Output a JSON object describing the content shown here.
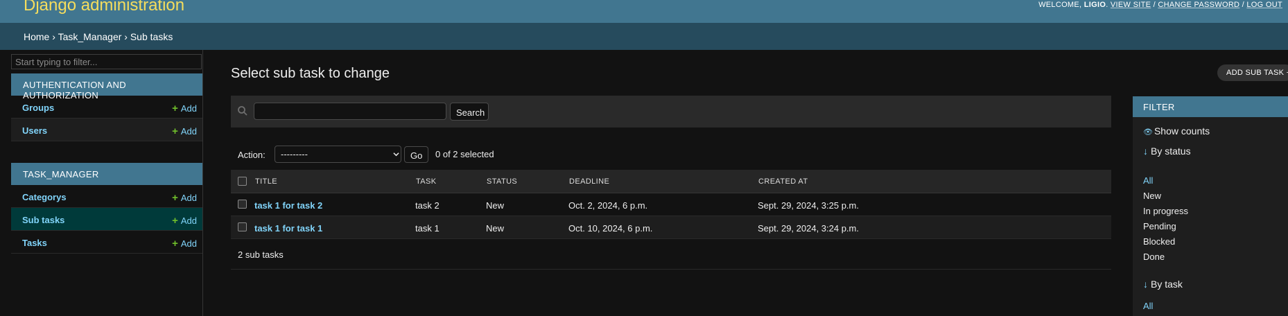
{
  "header": {
    "brand": "Django administration",
    "welcome": "WELCOME,",
    "username": "LIGIO",
    "view_site": "VIEW SITE",
    "change_password": "CHANGE PASSWORD",
    "log_out": "LOG OUT",
    "separator": "/"
  },
  "breadcrumbs": {
    "home": "Home",
    "app": "Task_Manager",
    "current": "Sub tasks",
    "separator": "›"
  },
  "sidebar": {
    "filter_placeholder": "Start typing to filter...",
    "apps": [
      {
        "caption": "AUTHENTICATION AND AUTHORIZATION",
        "models": [
          {
            "name": "Groups",
            "add": "Add"
          },
          {
            "name": "Users",
            "add": "Add"
          }
        ]
      },
      {
        "caption": "TASK_MANAGER",
        "models": [
          {
            "name": "Categorys",
            "add": "Add"
          },
          {
            "name": "Sub tasks",
            "add": "Add"
          },
          {
            "name": "Tasks",
            "add": "Add"
          }
        ]
      }
    ]
  },
  "content": {
    "title": "Select sub task to change",
    "add_button": "ADD SUB TASK",
    "search_button": "Search",
    "search_value": "",
    "action_label": "Action:",
    "action_selected": "---------",
    "go_button": "Go",
    "selection_count": "0 of 2 selected",
    "columns": [
      "TITLE",
      "TASK",
      "STATUS",
      "DEADLINE",
      "CREATED AT"
    ],
    "rows": [
      {
        "title": "task 1 for task 2",
        "task": "task 2",
        "status": "New",
        "deadline": "Oct. 2, 2024, 6 p.m.",
        "created_at": "Sept. 29, 2024, 3:25 p.m."
      },
      {
        "title": "task 1 for task 1",
        "task": "task 1",
        "status": "New",
        "deadline": "Oct. 10, 2024, 6 p.m.",
        "created_at": "Sept. 29, 2024, 3:24 p.m."
      }
    ],
    "result_count": "2 sub tasks"
  },
  "filter": {
    "header": "FILTER",
    "show_counts": "Show counts",
    "by_status": {
      "title": "By status",
      "options": [
        "All",
        "New",
        "In progress",
        "Pending",
        "Blocked",
        "Done"
      ],
      "selected": "All"
    },
    "by_task": {
      "title": "By task",
      "options": [
        "All"
      ],
      "selected": "All"
    }
  },
  "colors": {
    "header_bg": "#417690",
    "brand": "#f5dd5d",
    "breadcrumbs_bg": "#264b5d",
    "link": "#81d4fa",
    "add_plus": "#70bf2b",
    "current_model_bg": "#003a3a",
    "page_bg": "#121212"
  },
  "icons": {
    "add": "plus-icon",
    "search": "search-icon",
    "show_counts": "eye-icon",
    "filter_section": "down-arrow-icon"
  }
}
